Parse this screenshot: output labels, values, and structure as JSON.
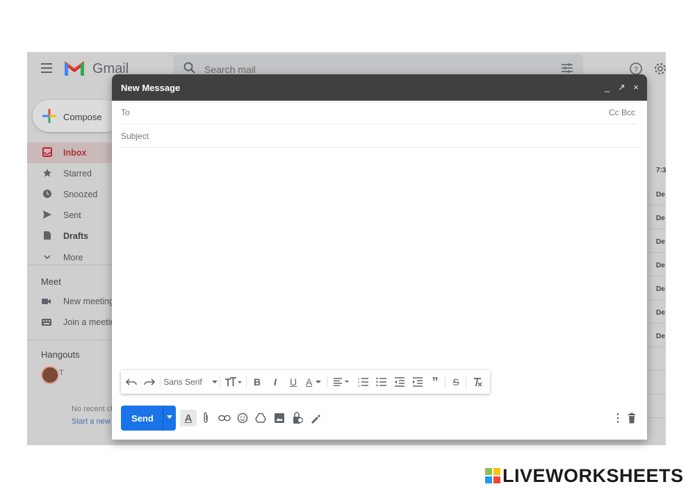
{
  "gmail": {
    "brand": "Gmail",
    "search_placeholder": "Search mail",
    "compose_label": "Compose",
    "nav": [
      "Inbox",
      "Starred",
      "Snoozed",
      "Sent",
      "Drafts",
      "More"
    ],
    "meet_header": "Meet",
    "meet_items": [
      "New meeting",
      "Join a meeting"
    ],
    "hangouts_header": "Hangouts",
    "hangouts_user": "T",
    "no_recent": "No recent chats",
    "start_new": "Start a new one",
    "right_column": [
      "7:3",
      "De",
      "De",
      "De",
      "De",
      "De",
      "De",
      "De"
    ],
    "colors": {
      "brand_red": "#d93025",
      "accent_blue": "#1a73e8"
    }
  },
  "compose": {
    "title": "New Message",
    "controls": [
      "_",
      "↗",
      "×"
    ],
    "to_label": "To",
    "cc_bcc": "Cc Bcc",
    "subject_label": "Subject",
    "font_name": "Sans Serif",
    "send_label": "Send"
  },
  "watermark": {
    "text": "LIVEWORKSHEETS"
  }
}
